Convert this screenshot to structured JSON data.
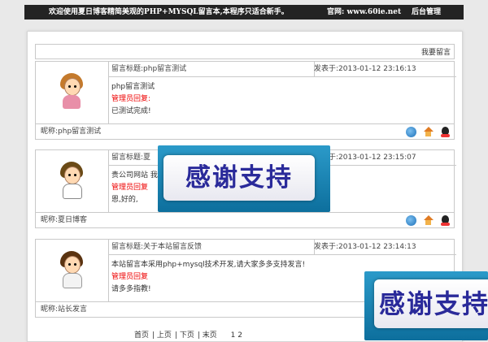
{
  "header": {
    "welcome": "欢迎使用夏日博客精简美观的PHP+MYSQL留言本,本程序只适合新手。",
    "site": "官网: www.60ie.net",
    "admin": "后台管理"
  },
  "post_link": "我要留言",
  "messages": [
    {
      "title": "留言标题:php留言测试",
      "time": "发表于:2013-01-12 23:16:13",
      "content": "php留言测试",
      "reply_label": "管理员回复:",
      "reply": "已测试完成!",
      "nickname": "昵称:php留言测试"
    },
    {
      "title": "留言标题:夏",
      "time": "发表于:2013-01-12 23:15:07",
      "content": "贵公司网站 我们联系!",
      "reply_label": "管理员回复",
      "reply": "恩,好的,",
      "nickname": "昵称:夏日博客"
    },
    {
      "title": "留言标题:关于本站留言反馈",
      "time": "发表于:2013-01-12 23:14:13",
      "content": "本站留言本采用php+mysql技术开发,请大家多多支持发言!",
      "reply_label": "管理员回复",
      "reply": "请多多指教!",
      "nickname": "昵称:站长发言"
    }
  ],
  "pager": {
    "first": "首页",
    "prev": "上页",
    "next": "下页",
    "last": "末页",
    "pages": "1 2"
  },
  "banners": [
    "感谢支持",
    "感谢支持"
  ],
  "icons": [
    "web-icon",
    "home-icon",
    "qq-icon"
  ]
}
